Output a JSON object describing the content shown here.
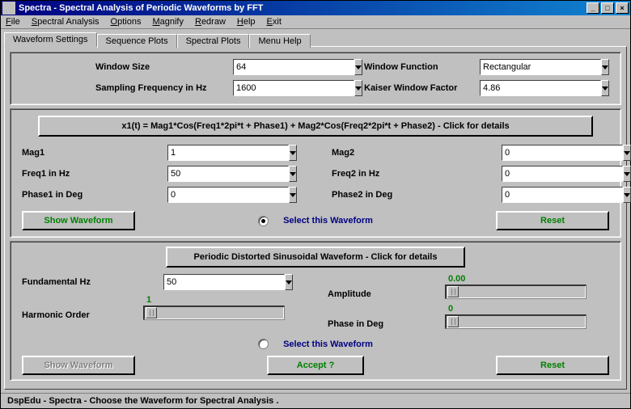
{
  "window": {
    "title": "Spectra - Spectral Analysis of Periodic Waveforms by FFT"
  },
  "menu": {
    "items": [
      "File",
      "Spectral Analysis",
      "Options",
      "Magnify",
      "Redraw",
      "Help",
      "Exit"
    ]
  },
  "tabs": {
    "items": [
      "Waveform Settings",
      "Sequence Plots",
      "Spectral Plots",
      "Menu Help"
    ],
    "active": 0
  },
  "top_panel": {
    "window_size_label": "Window Size",
    "window_size_value": "64",
    "window_function_label": "Window Function",
    "window_function_value": "Rectangular",
    "sampling_freq_label": "Sampling Frequency in Hz",
    "sampling_freq_value": "1600",
    "kaiser_label": "Kaiser Window Factor",
    "kaiser_value": "4.86"
  },
  "section1": {
    "formula": "x1(t) =  Mag1*Cos(Freq1*2pi*t + Phase1) +  Mag2*Cos(Freq2*2pi*t + Phase2) - Click for details",
    "mag1_label": "Mag1",
    "mag1_value": "1",
    "freq1_label": "Freq1 in Hz",
    "freq1_value": "50",
    "phase1_label": "Phase1 in Deg",
    "phase1_value": "0",
    "mag2_label": "Mag2",
    "mag2_value": "0",
    "freq2_label": "Freq2 in Hz",
    "freq2_value": "0",
    "phase2_label": "Phase2 in Deg",
    "phase2_value": "0",
    "show_btn": "Show Waveform",
    "select_text": "Select this Waveform",
    "reset_btn": "Reset"
  },
  "section2": {
    "header": "Periodic Distorted Sinusoidal Waveform - Click for details",
    "fundamental_label": "Fundamental Hz",
    "fundamental_value": "50",
    "amplitude_label": "Amplitude",
    "amplitude_value": "0.00",
    "harmonic_label": "Harmonic Order",
    "harmonic_value": "1",
    "phase_label": "Phase in Deg",
    "phase_value": "0",
    "select_text": "Select this Waveform",
    "show_btn": "Show Waveform",
    "accept_btn": "Accept ?",
    "reset_btn": "Reset"
  },
  "statusbar": {
    "text": "DspEdu - Spectra - Choose the Waveform for Spectral Analysis ."
  }
}
